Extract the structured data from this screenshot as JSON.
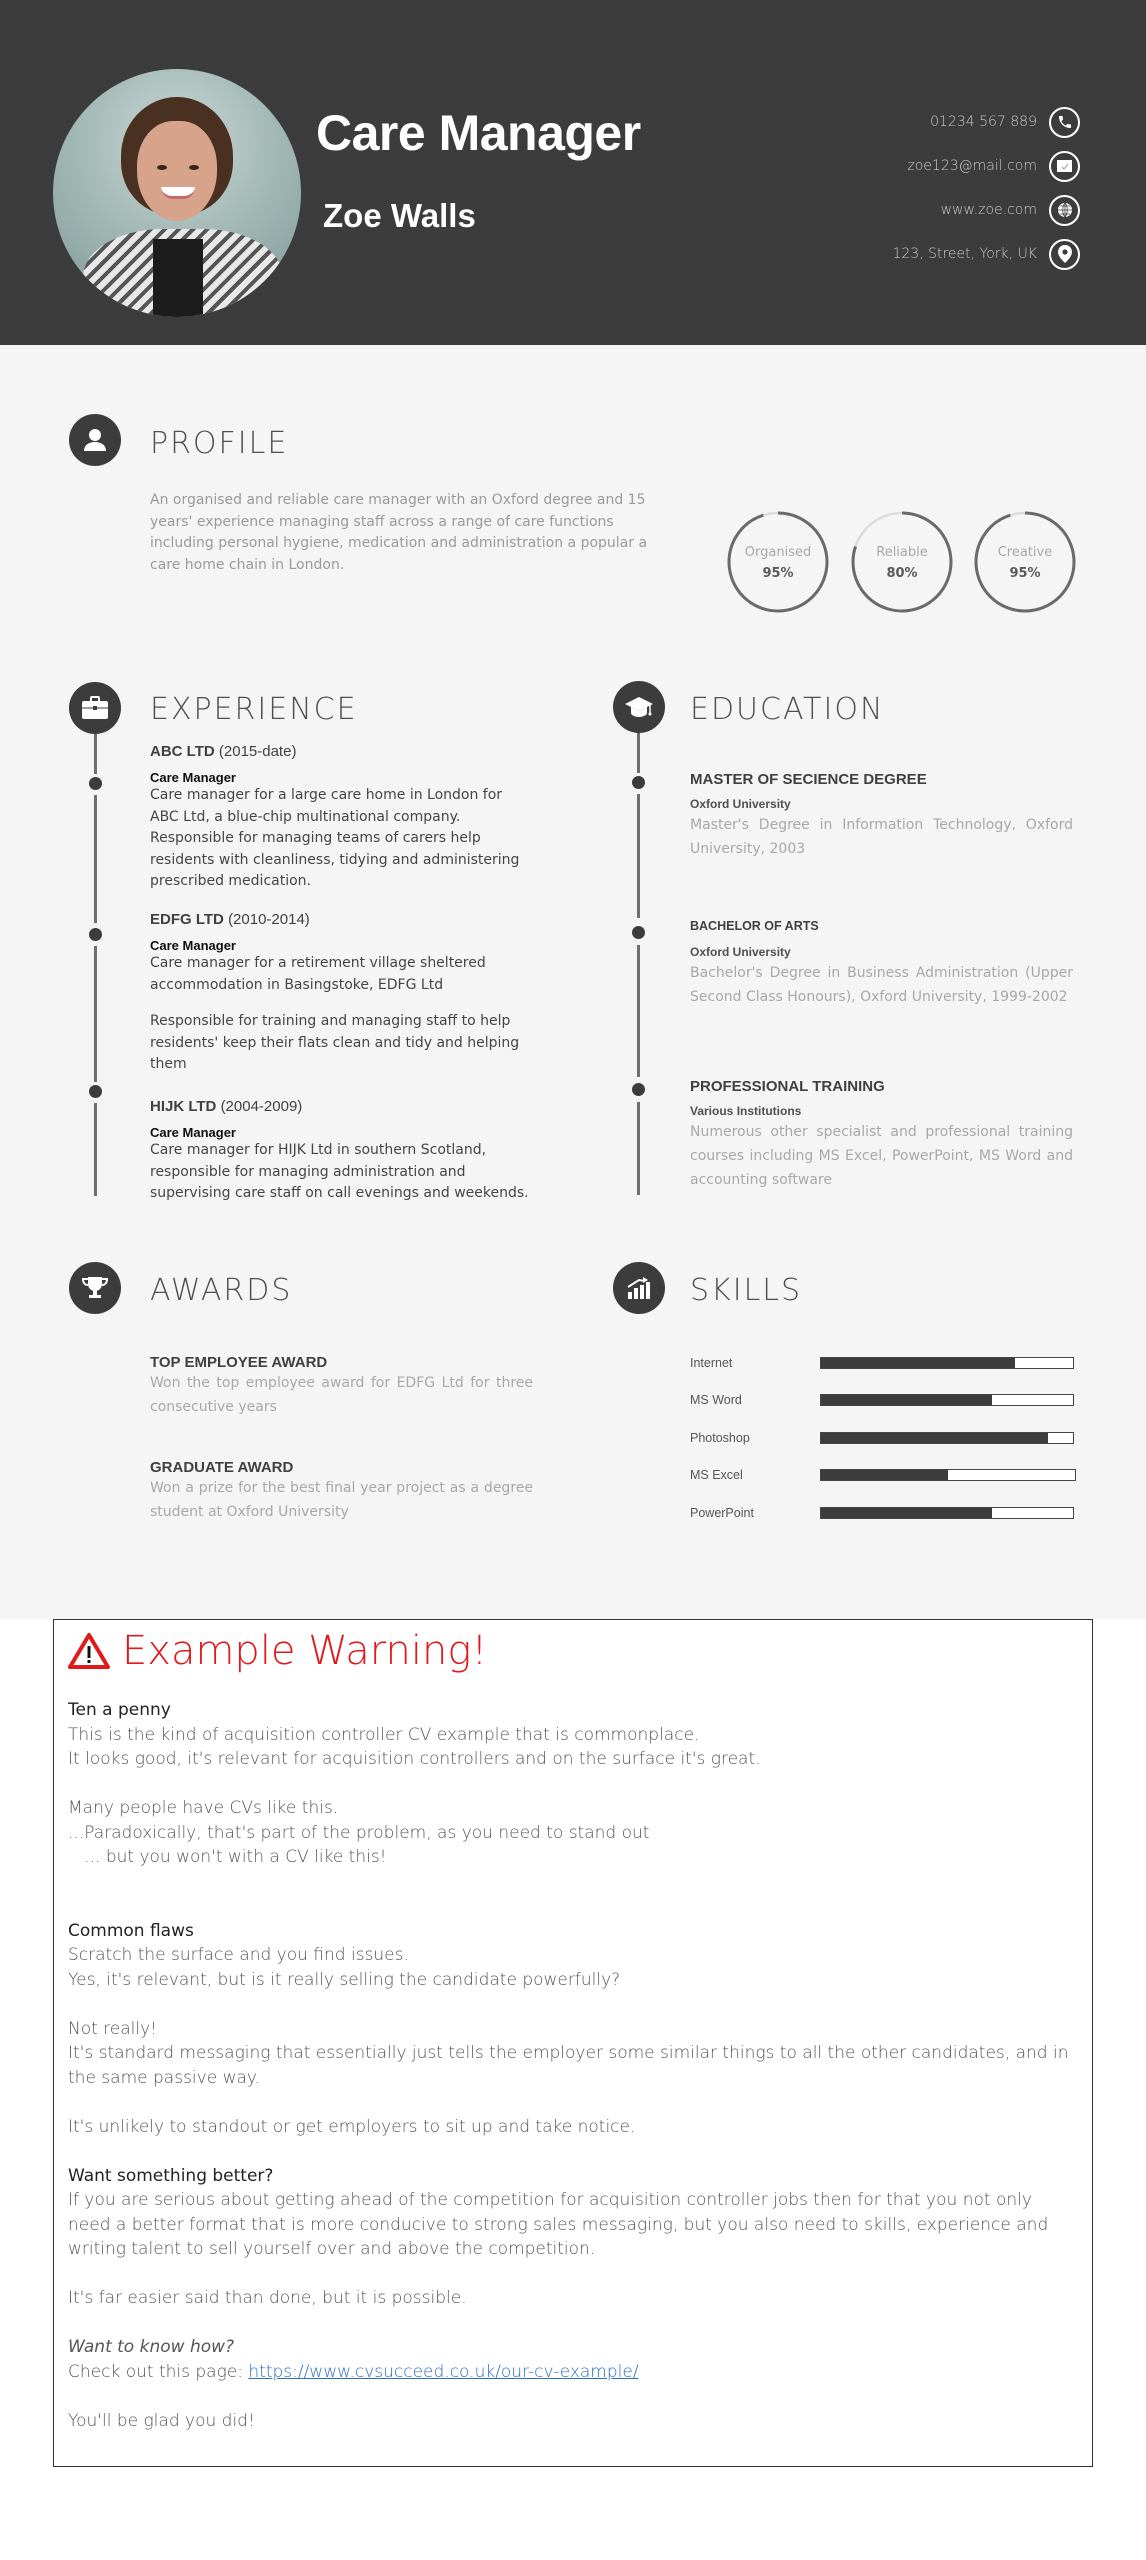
{
  "header": {
    "job_title": "Care Manager",
    "name": "Zoe Walls",
    "photo_alt": "profile photo",
    "contacts": [
      {
        "icon": "phone-icon",
        "text": "01234 567 889"
      },
      {
        "icon": "email-icon",
        "text": "zoe123@mail.com"
      },
      {
        "icon": "globe-icon",
        "text": "www.zoe.com"
      },
      {
        "icon": "location-pin-icon",
        "text": "123, Street, York, UK"
      }
    ]
  },
  "profile": {
    "title": "PROFILE",
    "text": "An organised and reliable care manager with an Oxford degree and 15 years' experience managing staff across a range of care functions including personal hygiene, medication and administration a popular a care home chain in London.",
    "traits": [
      {
        "label": "Organised",
        "value": "95%",
        "fraction": 0.95
      },
      {
        "label": "Reliable",
        "value": "80%",
        "fraction": 0.8
      },
      {
        "label": "Creative",
        "value": "95%",
        "fraction": 0.95
      }
    ]
  },
  "experience": {
    "title": "EXPERIENCE",
    "items": [
      {
        "company": "ABC LTD",
        "dates": "(2015-date)",
        "role": "Care Manager",
        "desc": [
          "Care manager for a large care home in London for ABC Ltd, a blue-chip multinational company. Responsible for managing teams of carers help residents with cleanliness, tidying and administering prescribed medication."
        ]
      },
      {
        "company": "EDFG LTD",
        "dates": "(2010-2014)",
        "role": "Care Manager",
        "desc": [
          "Care manager for a retirement village sheltered accommodation in Basingstoke, EDFG Ltd",
          "Responsible for training and managing staff to help residents' keep their flats clean and tidy and helping them"
        ]
      },
      {
        "company": "HIJK LTD",
        "dates": "(2004-2009)",
        "role": "Care Manager",
        "desc": [
          "Care manager for HIJK Ltd in southern Scotland, responsible for managing administration and supervising care staff on call evenings and weekends."
        ]
      }
    ]
  },
  "education": {
    "title": "EDUCATION",
    "items": [
      {
        "degree": "MASTER OF SECIENCE DEGREE",
        "institution": "Oxford University",
        "desc": "Master's Degree in Information Technology, Oxford University, 2003"
      },
      {
        "degree": "BACHELOR OF ARTS",
        "institution": "Oxford University",
        "desc": "Bachelor's Degree in Business Administration (Upper Second Class Honours), Oxford University, 1999-2002"
      },
      {
        "degree": "PROFESSIONAL TRAINING",
        "institution": "Various Institutions",
        "desc": "Numerous other specialist and professional training courses including MS Excel, PowerPoint, MS Word and accounting software"
      }
    ]
  },
  "awards": {
    "title": "AWARDS",
    "items": [
      {
        "title": "TOP EMPLOYEE AWARD",
        "desc": "Won the top employee award for EDFG Ltd for three consecutive years"
      },
      {
        "title": "GRADUATE AWARD",
        "desc": "Won a prize for the best final year project as a degree student at Oxford University"
      }
    ]
  },
  "skills": {
    "title": "SKILLS",
    "items": [
      {
        "label": "Internet",
        "level": 0.77
      },
      {
        "label": "MS Word",
        "level": 0.68
      },
      {
        "label": "Photoshop",
        "level": 0.9
      },
      {
        "label": "MS Excel",
        "level": 0.5
      },
      {
        "label": "PowerPoint",
        "level": 0.68
      }
    ]
  },
  "warning": {
    "title": "Example Warning!",
    "accent_color": "#e0191b",
    "section1_heading": "Ten a penny",
    "section1_lines": [
      "This is the kind of acquisition controller CV example that is commonplace.",
      "It looks good, it's relevant for acquisition controllers and on the surface it's great."
    ],
    "section1b_lines": [
      "Many people have CVs like this.",
      "...Paradoxically, that's part of the problem, as you need to stand out",
      "   ... but you won't with a CV like this!"
    ],
    "section2_heading": "Common flaws",
    "section2_lines": [
      "Scratch the surface and you find issues.",
      "Yes, it's relevant, but is it really selling the candidate powerfully?"
    ],
    "section2b_lines": [
      "Not really!",
      "It's standard messaging that essentially just tells the employer some similar things to all the other candidates, and in the same passive way."
    ],
    "section2c": "It's unlikely to standout or get employers to sit up and take notice.",
    "section3_heading": "Want something better?",
    "section3_text": "If you are serious about getting ahead of the competition for acquisition controller jobs then for that you not only need a better format that is more conducive to strong sales messaging, but you also need to skills, experience and writing talent to sell yourself over and above the competition.",
    "section3b": "It's far easier said than done, but it is possible.",
    "cta_question": "Want to know how?",
    "cta_prefix": "Check out this page: ",
    "cta_link": "https://www.cvsucceed.co.uk/our-cv-example/",
    "closing": "You'll be glad you did!"
  }
}
